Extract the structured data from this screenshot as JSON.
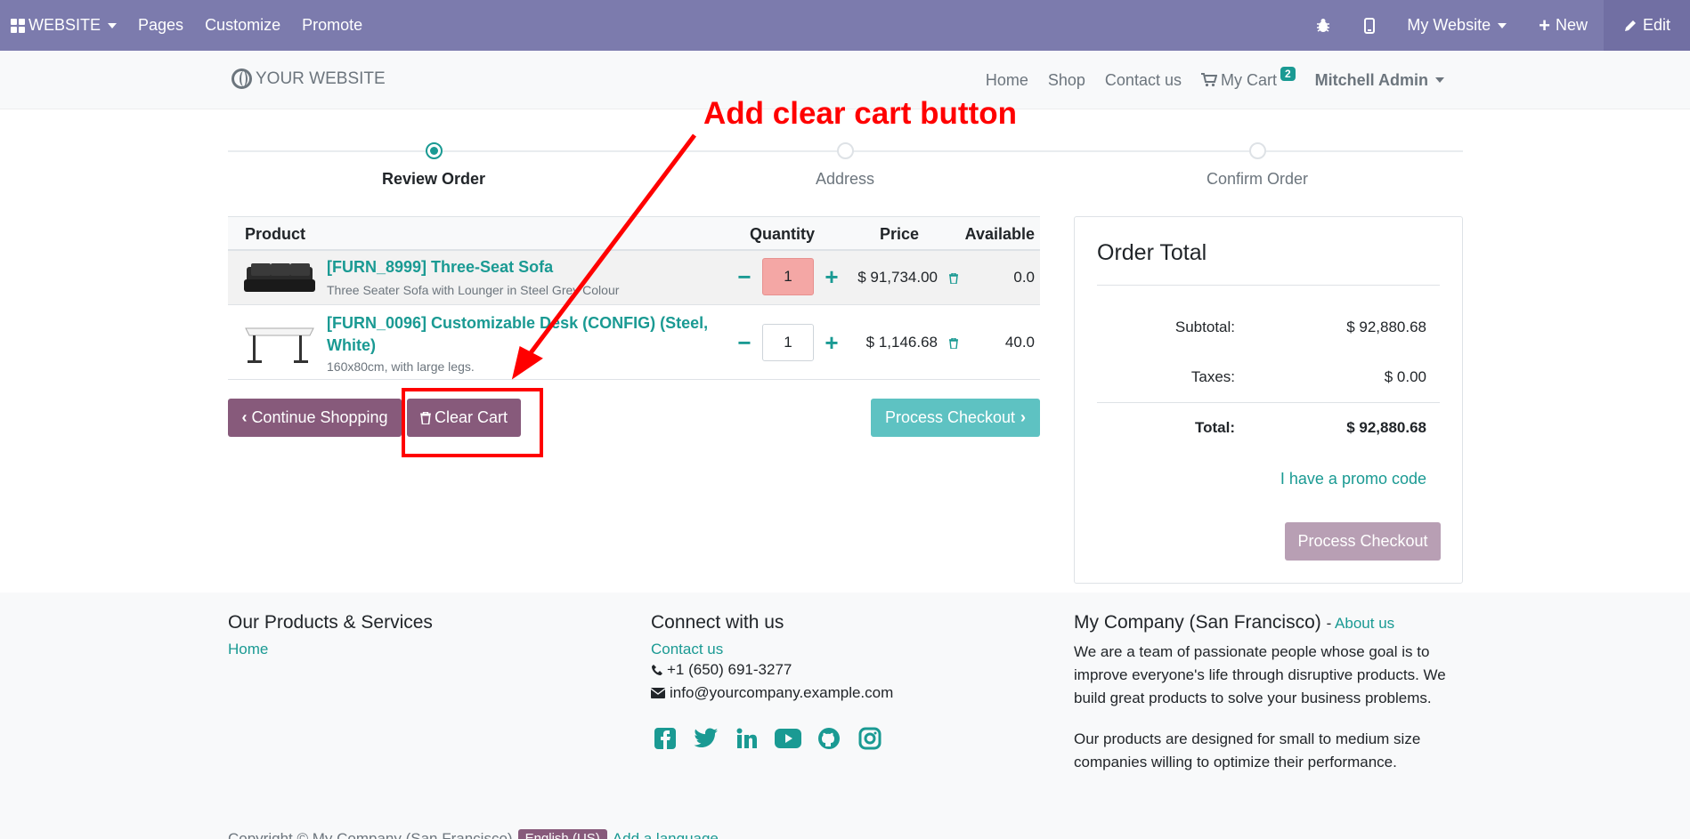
{
  "admin_bar": {
    "website_label": "WEBSITE",
    "pages": "Pages",
    "customize": "Customize",
    "promote": "Promote",
    "my_website": "My Website",
    "new": "New",
    "edit": "Edit"
  },
  "site_header": {
    "logo": "YOUR WEBSITE",
    "nav": [
      "Home",
      "Shop",
      "Contact us"
    ],
    "cart_label": "My Cart",
    "cart_count": "2",
    "user": "Mitchell Admin"
  },
  "wizard": {
    "steps": [
      "Review Order",
      "Address",
      "Confirm Order"
    ],
    "active_index": 0
  },
  "cart": {
    "headers": {
      "product": "Product",
      "quantity": "Quantity",
      "price": "Price",
      "available": "Available"
    },
    "items": [
      {
        "name": "[FURN_8999] Three-Seat Sofa",
        "description": "Three Seater Sofa with Lounger in Steel Grey Colour",
        "quantity": "1",
        "price": "$ 91,734.00",
        "available": "0.0"
      },
      {
        "name": "[FURN_0096] Customizable Desk (CONFIG) (Steel, White)",
        "description": "160x80cm, with large legs.",
        "quantity": "1",
        "price": "$ 1,146.68",
        "available": "40.0"
      }
    ],
    "continue_shopping": "Continue Shopping",
    "clear_cart": "Clear Cart",
    "process_checkout": "Process Checkout"
  },
  "order_total": {
    "title": "Order Total",
    "subtotal_label": "Subtotal:",
    "subtotal": "$ 92,880.68",
    "taxes_label": "Taxes:",
    "taxes": "$ 0.00",
    "total_label": "Total:",
    "total": "$ 92,880.68",
    "promo": "I have a promo code",
    "process_checkout": "Process Checkout"
  },
  "footer": {
    "products_title": "Our Products & Services",
    "products_link": "Home",
    "connect_title": "Connect with us",
    "contact_link": "Contact us",
    "phone": "+1 (650) 691-3277",
    "email": "info@yourcompany.example.com",
    "company_title": "My Company (San Francisco)",
    "about_link": "About us",
    "about_p1": "We are a team of passionate people whose goal is to improve everyone's life through disruptive products. We build great products to solve your business problems.",
    "about_p2": "Our products are designed for small to medium size companies willing to optimize their performance.",
    "copyright": "Copyright © My Company (San Francisco)",
    "language": "English (US)",
    "add_language": "Add a language..."
  },
  "annotation": {
    "text": "Add clear cart button"
  },
  "colors": {
    "admin_bar": "#7c7bad",
    "primary": "#875a7b",
    "accent": "#1a9a93",
    "annotation": "#ff0000"
  }
}
